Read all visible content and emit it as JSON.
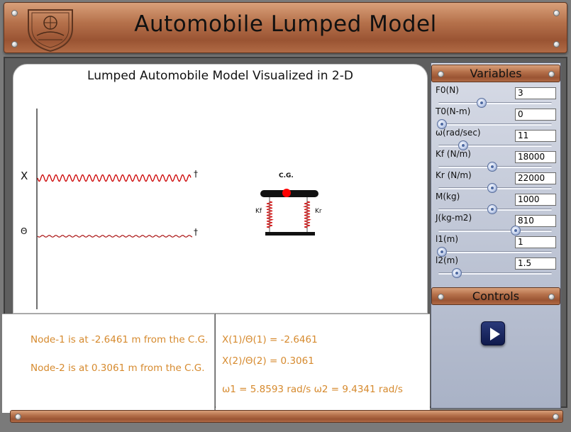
{
  "header": {
    "title": "Automobile Lumped Model"
  },
  "viz": {
    "title": "Lumped Automobile Model Visualized in 2-D",
    "x_label": "X",
    "theta_label": "Θ",
    "dagger": "†",
    "cg_label": "C.G.",
    "kf_label": "Kf",
    "kr_label": "Kr"
  },
  "results": {
    "node1": "Node-1 is at -2.6461 m from the C.G.",
    "node2": "Node-2 is at 0.3061 m from the C.G.",
    "ratio1": "X(1)/Θ(1) = -2.6461",
    "ratio2": "X(2)/Θ(2) =  0.3061",
    "omega": "ω1 = 5.8593 rad/s   ω2 = 9.4341 rad/s"
  },
  "variables": {
    "title": "Variables",
    "items": [
      {
        "label": "F0(N)",
        "value": "3",
        "slider": 0.37
      },
      {
        "label": "T0(N-m)",
        "value": "0",
        "slider": 0.0
      },
      {
        "label": "ω(rad/sec)",
        "value": "11",
        "slider": 0.2
      },
      {
        "label": "Kf (N/m)",
        "value": "18000",
        "slider": 0.47
      },
      {
        "label": "Kr (N/m)",
        "value": "22000",
        "slider": 0.47
      },
      {
        "label": "M(kg)",
        "value": "1000",
        "slider": 0.47
      },
      {
        "label": "J(kg-m2)",
        "value": "810",
        "slider": 0.69
      },
      {
        "label": "l1(m)",
        "value": "1",
        "slider": 0.0
      },
      {
        "label": "l2(m)",
        "value": "1.5",
        "slider": 0.14
      }
    ]
  },
  "controls": {
    "title": "Controls",
    "play_icon": "play-icon"
  },
  "colors": {
    "accent_orange": "#d68a2e",
    "wave_red": "#cc0000",
    "cg_dot": "#ff0000",
    "copper": "#b5714b",
    "play_blue": "#1a2660"
  }
}
